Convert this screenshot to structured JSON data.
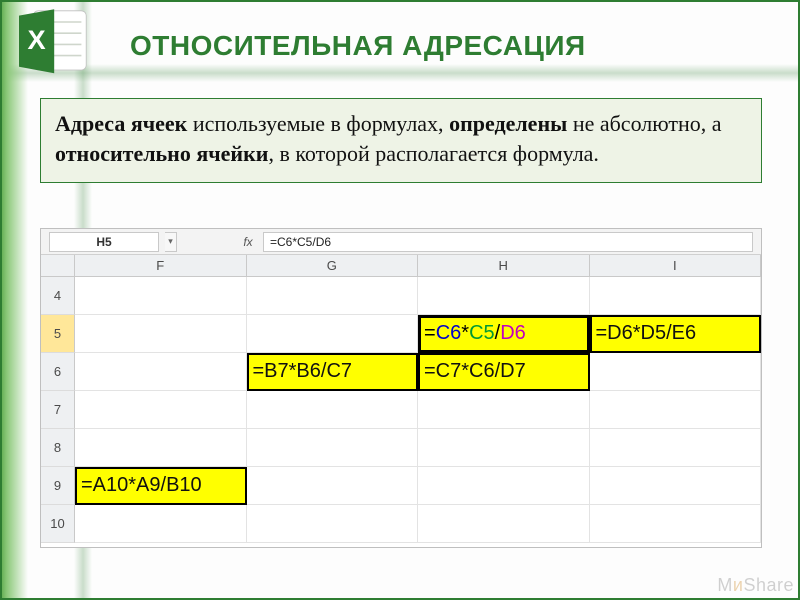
{
  "slide": {
    "title": "ОТНОСИТЕЛЬНАЯ АДРЕСАЦИЯ",
    "definition_parts": {
      "b1": "Адреса ячеек",
      "t1": " используемые в формулах, ",
      "b2": "определены",
      "t2": " не абсолютно, а ",
      "b3": "относительно ячейки",
      "t3": ", в которой располагается формула."
    },
    "watermark_a": "M",
    "watermark_b": "и",
    "watermark_c": "S",
    "watermark_d": "hare"
  },
  "excel": {
    "namebox": "H5",
    "fx_label": "fx",
    "formula_bar": "=C6*C5/D6",
    "columns": [
      "F",
      "G",
      "H",
      "I"
    ],
    "rows": [
      "4",
      "5",
      "6",
      "7",
      "8",
      "9",
      "10"
    ],
    "selected_row": "5",
    "cells": {
      "H5": {
        "eq": "=",
        "r1": "C6",
        "op1": "*",
        "r2": "C5",
        "op2": "/",
        "r3": "D6"
      },
      "I5": {
        "text": "=D6*D5/E6"
      },
      "G6": {
        "text": "=B7*B6/C7"
      },
      "H6": {
        "text": "=C7*C6/D7"
      },
      "F9": {
        "text": "=A10*A9/B10"
      }
    }
  }
}
